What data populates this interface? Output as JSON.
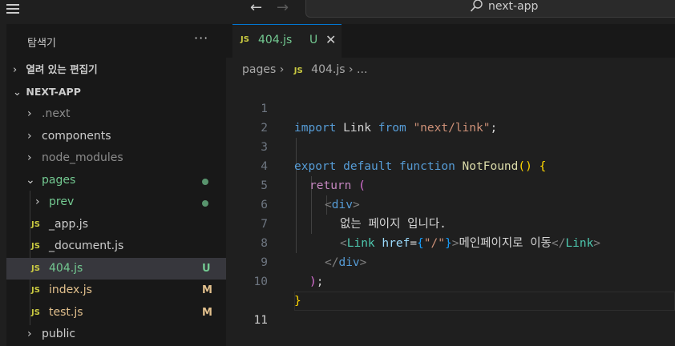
{
  "titlebar": {
    "search_text": "next-app",
    "icons": [
      "menu-icon",
      "arrow-left-icon",
      "arrow-right-icon",
      "search-icon"
    ]
  },
  "explorer": {
    "title": "탐색기",
    "more": "···",
    "open_editors_label": "열려 있는 편집기",
    "project_label": "NEXT-APP",
    "tree": [
      {
        "label": ".next",
        "type": "folder",
        "badge": ""
      },
      {
        "label": "components",
        "type": "folder",
        "badge": ""
      },
      {
        "label": "node_modules",
        "type": "folder",
        "badge": ""
      },
      {
        "label": "pages",
        "type": "folder-open",
        "badge": "dot"
      },
      {
        "label": "prev",
        "type": "folder",
        "badge": "dot"
      },
      {
        "label": "_app.js",
        "type": "file",
        "badge": ""
      },
      {
        "label": "_document.js",
        "type": "file",
        "badge": ""
      },
      {
        "label": "404.js",
        "type": "file",
        "badge": "U"
      },
      {
        "label": "index.js",
        "type": "file",
        "badge": "M"
      },
      {
        "label": "test.js",
        "type": "file",
        "badge": "M"
      },
      {
        "label": "public",
        "type": "folder",
        "badge": ""
      }
    ],
    "js_icon_text": "JS"
  },
  "editor": {
    "tab": {
      "icon_text": "JS",
      "name": "404.js",
      "status": "U",
      "close": "✕"
    },
    "breadcrumbs": {
      "folder": "pages",
      "sep": "›",
      "icon_text": "JS",
      "file": "404.js",
      "more": "..."
    },
    "line_numbers": [
      "1",
      "2",
      "3",
      "4",
      "5",
      "6",
      "7",
      "8",
      "9",
      "10",
      "11"
    ],
    "code": {
      "l1": {
        "kw1": "import",
        "name": " Link ",
        "kw2": "from",
        "sp": " ",
        "str": "\"next/link\"",
        "end": ";"
      },
      "l3": {
        "kw1": "export",
        "kw2": " default",
        "kw3": " function",
        "fn": " NotFound",
        "paren": "()",
        "sp": " ",
        "brace": "{"
      },
      "l4": {
        "kw": "return",
        "sp": " ",
        "paren": "("
      },
      "l5": {
        "open": "<",
        "tag": "div",
        "close": ">"
      },
      "l6": {
        "text": "없는 페이지 입니다."
      },
      "l7": {
        "open": "<",
        "comp": "Link",
        "attr": " href",
        "eq": "=",
        "b1": "{",
        "str": "\"/\"",
        "b2": "}",
        "gt": ">",
        "text": "메인페이지로 이동",
        "copen": "</",
        "ccomp": "Link",
        "cgt": ">"
      },
      "l8": {
        "copen": "</",
        "tag": "div",
        "cgt": ">"
      },
      "l9": {
        "paren": ")",
        "semi": ";"
      },
      "l10": {
        "brace": "}"
      }
    }
  }
}
